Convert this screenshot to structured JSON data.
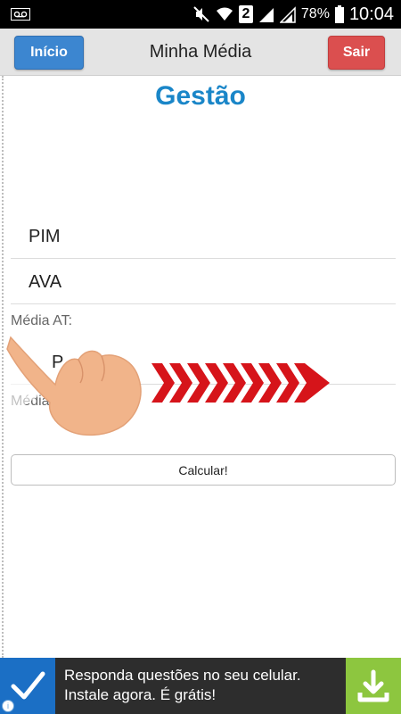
{
  "status_bar": {
    "sim_label": "2",
    "battery": "78%",
    "time": "10:04",
    "icons": [
      "voicemail-icon",
      "mute-icon",
      "wifi-icon",
      "signal-icon",
      "battery-icon"
    ]
  },
  "header": {
    "left_button": "Início",
    "title": "Minha Média",
    "right_button": "Sair",
    "colors": {
      "inicio": "#3c86d0",
      "sair": "#db4f4f"
    }
  },
  "main": {
    "heading": "Gestão",
    "heading_color": "#1a86c8",
    "fields": [
      {
        "label": "PIM"
      },
      {
        "label": "AVA"
      }
    ],
    "media_at_label": "Média AT:",
    "third_field_partial": "P",
    "media_partial_label": "Média",
    "calc_button": "Calcular!"
  },
  "overlay": {
    "hand_icon": "pointing-hand-icon",
    "arrows_icon": "chevron-arrows-icon",
    "arrow_color": "#d6141a"
  },
  "ad": {
    "line1": "Responda questões no seu celular.",
    "line2": "Instale agora. É grátis!",
    "info_glyph": "i",
    "left_icon": "checkmark-icon",
    "right_icon": "download-icon"
  }
}
